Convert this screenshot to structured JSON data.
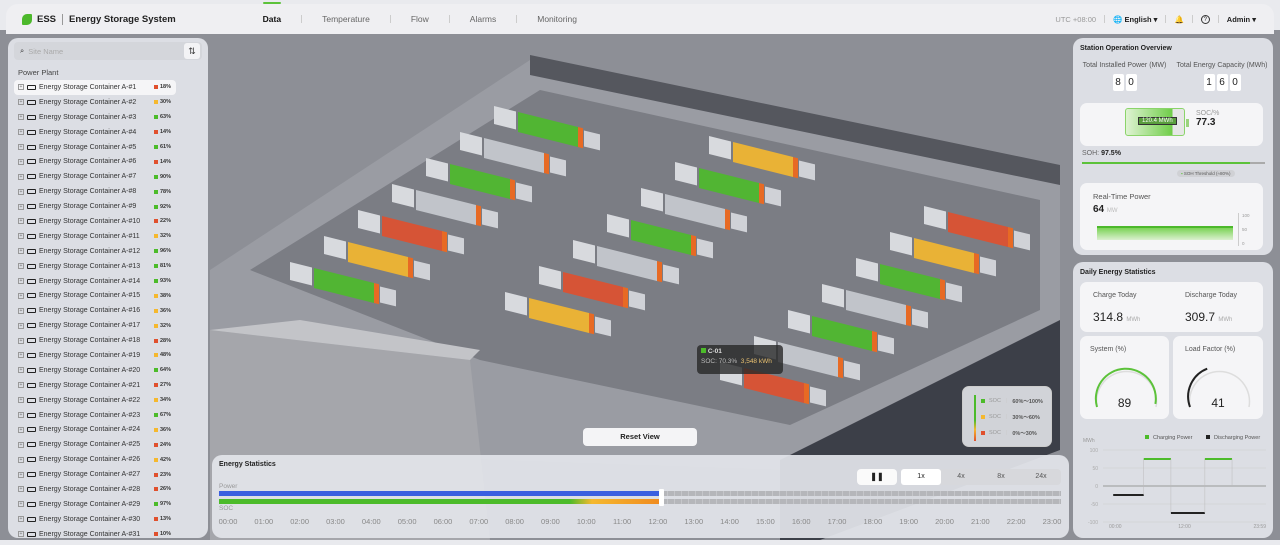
{
  "header": {
    "brand": "ESS",
    "title": "Energy Storage System",
    "tabs": [
      {
        "label": "Data",
        "active": true
      },
      {
        "label": "Temperature"
      },
      {
        "label": "Flow"
      },
      {
        "label": "Alarms"
      },
      {
        "label": "Monitoring"
      }
    ],
    "timezone": "UTC +08:00",
    "language": "English",
    "user": "Admin"
  },
  "sidebar": {
    "search_placeholder": "Site Name",
    "group": "Power Plant",
    "items": [
      {
        "name": "Energy Storage Container A-#1",
        "soc": "18%",
        "level": "low"
      },
      {
        "name": "Energy Storage Container A-#2",
        "soc": "30%",
        "level": "mid"
      },
      {
        "name": "Energy Storage Container A-#3",
        "soc": "63%",
        "level": "high"
      },
      {
        "name": "Energy Storage Container A-#4",
        "soc": "14%",
        "level": "low"
      },
      {
        "name": "Energy Storage Container A-#5",
        "soc": "61%",
        "level": "high"
      },
      {
        "name": "Energy Storage Container A-#6",
        "soc": "14%",
        "level": "low"
      },
      {
        "name": "Energy Storage Container A-#7",
        "soc": "90%",
        "level": "high"
      },
      {
        "name": "Energy Storage Container A-#8",
        "soc": "78%",
        "level": "high"
      },
      {
        "name": "Energy Storage Container A-#9",
        "soc": "92%",
        "level": "high"
      },
      {
        "name": "Energy Storage Container A-#10",
        "soc": "22%",
        "level": "low"
      },
      {
        "name": "Energy Storage Container A-#11",
        "soc": "32%",
        "level": "mid"
      },
      {
        "name": "Energy Storage Container A-#12",
        "soc": "96%",
        "level": "high"
      },
      {
        "name": "Energy Storage Container A-#13",
        "soc": "81%",
        "level": "high"
      },
      {
        "name": "Energy Storage Container A-#14",
        "soc": "93%",
        "level": "high"
      },
      {
        "name": "Energy Storage Container A-#15",
        "soc": "38%",
        "level": "mid"
      },
      {
        "name": "Energy Storage Container A-#16",
        "soc": "36%",
        "level": "mid"
      },
      {
        "name": "Energy Storage Container A-#17",
        "soc": "32%",
        "level": "mid"
      },
      {
        "name": "Energy Storage Container A-#18",
        "soc": "28%",
        "level": "low"
      },
      {
        "name": "Energy Storage Container A-#19",
        "soc": "48%",
        "level": "mid"
      },
      {
        "name": "Energy Storage Container A-#20",
        "soc": "64%",
        "level": "high"
      },
      {
        "name": "Energy Storage Container A-#21",
        "soc": "27%",
        "level": "low"
      },
      {
        "name": "Energy Storage Container A-#22",
        "soc": "34%",
        "level": "mid"
      },
      {
        "name": "Energy Storage Container A-#23",
        "soc": "67%",
        "level": "high"
      },
      {
        "name": "Energy Storage Container A-#24",
        "soc": "36%",
        "level": "mid"
      },
      {
        "name": "Energy Storage Container A-#25",
        "soc": "24%",
        "level": "low"
      },
      {
        "name": "Energy Storage Container A-#26",
        "soc": "42%",
        "level": "mid"
      },
      {
        "name": "Energy Storage Container A-#27",
        "soc": "23%",
        "level": "low"
      },
      {
        "name": "Energy Storage Container A-#28",
        "soc": "26%",
        "level": "low"
      },
      {
        "name": "Energy Storage Container A-#29",
        "soc": "97%",
        "level": "high"
      },
      {
        "name": "Energy Storage Container A-#30",
        "soc": "13%",
        "level": "low"
      },
      {
        "name": "Energy Storage Container A-#31",
        "soc": "10%",
        "level": "low"
      }
    ]
  },
  "colors": {
    "high": "#4cbb2a",
    "mid": "#f5b82e",
    "low": "#e0502d",
    "accent": "#5cc23a",
    "power": "#3b5fe0"
  },
  "overview": {
    "title": "Station Operation Overview",
    "installed_power_label": "Total Installed Power (MW)",
    "installed_power_digits": [
      "8",
      "0"
    ],
    "capacity_label": "Total Energy Capacity (MWh)",
    "capacity_digits": [
      "1",
      "6",
      "0"
    ],
    "battery_energy": "120.4 MWh",
    "soc_label": "SOC/%",
    "soc_value": "77.3",
    "soh_label": "SOH:",
    "soh_value": "97.5%",
    "soh_percent": 97.5,
    "soh_threshold_label": "SOH Threshold (≈80%)",
    "realtime_label": "Real-Time Power",
    "realtime_value": "64",
    "realtime_unit": "MW",
    "realtime_ticks": [
      "100",
      "50",
      "0"
    ]
  },
  "daily": {
    "title": "Daily Energy Statistics",
    "charge_label": "Charge Today",
    "charge_value": "314.8",
    "discharge_label": "Discharge Today",
    "discharge_value": "309.7",
    "unit": "MWh",
    "system_label": "System (%)",
    "system_value": "89",
    "load_label": "Load Factor (%)",
    "load_value": "41"
  },
  "chart_data": {
    "type": "line",
    "ylabel": "MWh",
    "legend": [
      "Charging Power",
      "Discharging Power"
    ],
    "yticks": [
      "100",
      "50",
      "0",
      "-50",
      "-100"
    ],
    "xticks": [
      "00:00",
      "12:00",
      "23:59"
    ],
    "ylim": [
      -100,
      100
    ],
    "segments": [
      {
        "series": "Discharging Power",
        "from": 1.5,
        "to": 6,
        "value": -25
      },
      {
        "series": "Charging Power",
        "from": 6,
        "to": 10,
        "value": 75
      },
      {
        "series": "Discharging Power",
        "from": 10,
        "to": 15,
        "value": -75
      },
      {
        "series": "Charging Power",
        "from": 15,
        "to": 19,
        "value": 75
      }
    ]
  },
  "tooltip": {
    "id": "C-01",
    "soc_label": "SOC:",
    "soc": "70.3%",
    "energy": "3,548 kWh"
  },
  "legend": [
    {
      "label": "SOC",
      "range": "60%～100%",
      "level": "high"
    },
    {
      "label": "SOC",
      "range": "30%～60%",
      "level": "mid"
    },
    {
      "label": "SOC",
      "range": "0%～30%",
      "level": "low"
    }
  ],
  "reset_view": "Reset View",
  "energy_stats": {
    "title": "Energy Statistics",
    "power_label": "Power",
    "soc_label": "SOC",
    "progress_hours": 12.6,
    "soc_green_until": 10,
    "speeds": [
      "1x",
      "4x",
      "8x",
      "24x"
    ],
    "active_speed": "1x",
    "hours": [
      "00:00",
      "01:00",
      "02:00",
      "03:00",
      "04:00",
      "05:00",
      "06:00",
      "07:00",
      "08:00",
      "09:00",
      "10:00",
      "11:00",
      "12:00",
      "13:00",
      "14:00",
      "15:00",
      "16:00",
      "17:00",
      "18:00",
      "19:00",
      "20:00",
      "21:00",
      "22:00",
      "23:00"
    ]
  }
}
